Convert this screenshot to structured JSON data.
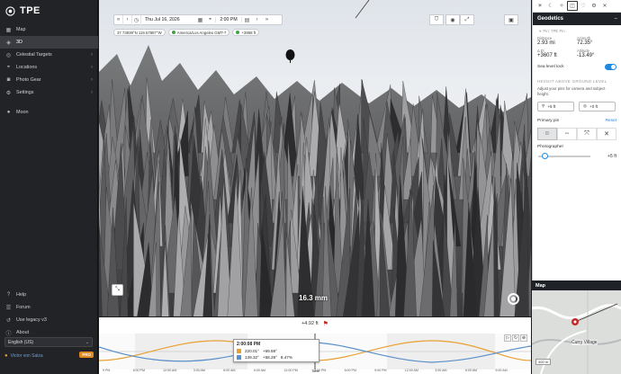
{
  "app": {
    "name": "TPE"
  },
  "sidebar": {
    "items": [
      {
        "label": "Map",
        "icon": "map-icon"
      },
      {
        "label": "3D",
        "icon": "cube-icon",
        "active": true
      },
      {
        "label": "Celestial Targets",
        "icon": "target-icon"
      },
      {
        "label": "Locations",
        "icon": "pin-icon"
      },
      {
        "label": "Photo Gear",
        "icon": "camera-icon"
      },
      {
        "label": "Settings",
        "icon": "gear-icon"
      }
    ],
    "moon_label": "Moon",
    "bottom_items": [
      {
        "label": "Help",
        "icon": "help-icon"
      },
      {
        "label": "Forum",
        "icon": "forum-icon"
      },
      {
        "label": "Use legacy v3",
        "icon": "legacy-icon"
      },
      {
        "label": "About",
        "icon": "info-icon"
      }
    ],
    "language": "English (US)",
    "user_name": "Victor von Salza",
    "pro_badge": "PRO"
  },
  "viewport": {
    "date": "Thu Jul 16, 2026",
    "time": "2:00 PM",
    "coords": "37.73939°N 119.57887°W",
    "timezone": "America/Los Angeles GMT-7",
    "elevation": "+3968 ft",
    "focal_length": "16.3 mm"
  },
  "geodetics": {
    "title": "Geodetics",
    "pin_label": "Pin: TPE Pin",
    "distance_label": "Distance",
    "distance_value": "2.93 mi",
    "azimuth_label": "Azimuth",
    "azimuth_value": "72.35°",
    "height_label": "Δ El",
    "height_value": "+3607 ft",
    "altitude_label": "Altitude",
    "altitude_value": "-13.49°",
    "sea_level_lock": "Sea level lock",
    "section_title": "HEIGHT ABOVE GROUND LEVEL",
    "section_desc": "Adjust your pins for camera and subject height.",
    "cam_height": "+5 ft",
    "subject_height": "+0 ft",
    "primary_pin": "Primary pin",
    "reset": "Reset",
    "photographer": "Photographer",
    "slider_value": "+5 ft"
  },
  "map": {
    "title": "Map",
    "place": "Curry Village",
    "scale": "300 m"
  },
  "timeline": {
    "elevation": "+4.92 ft",
    "tooltip_time": "2:00:08 PM",
    "sun_az": "220.01°",
    "sun_alt": "+69.59°",
    "moon_az": "139.32°",
    "moon_alt": "+58.29°",
    "moon_illum": "8.47%",
    "time_label": "Time",
    "ticks": [
      "9 PM",
      "6:00 PM",
      "12:00 AM",
      "3:00 AM",
      "6:00 AM",
      "9:00 AM",
      "12:00 PM",
      "3:00 PM",
      "6:00 PM",
      "9:00 PM",
      "12:00 AM",
      "3:00 AM",
      "6:00 AM",
      "9:00 AM"
    ]
  },
  "colors": {
    "accent": "#1e88e5",
    "pro": "#e08a22",
    "sun_line": "#e8a030",
    "moon_line": "#5b8fc9"
  }
}
